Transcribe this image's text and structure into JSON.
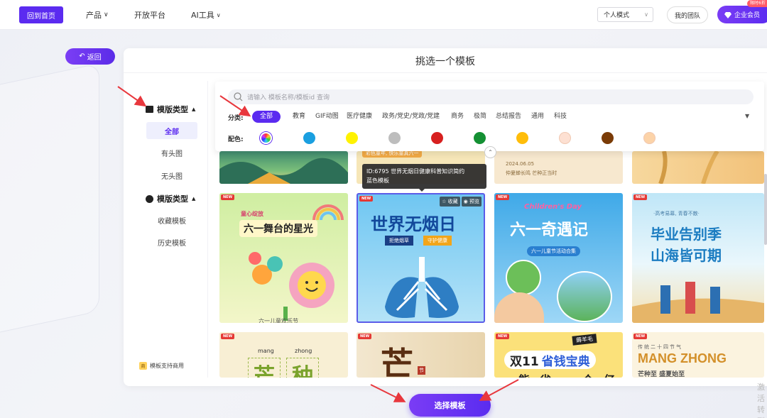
{
  "topbar": {
    "home_label": "回到首页",
    "nav": [
      {
        "label": "产品",
        "caret": true
      },
      {
        "label": "开放平台",
        "caret": false
      },
      {
        "label": "AI工具",
        "caret": true
      }
    ],
    "mode_select_value": "个人模式",
    "team_label": "我的团队",
    "vip_label": "企业会员",
    "vip_badge": "限时6折"
  },
  "back_label": "返回",
  "panel_title": "挑选一个模板",
  "sidebar": {
    "group1_title": "模版类型",
    "items1": [
      "全部",
      "有头图",
      "无头图"
    ],
    "group2_title": "模版类型",
    "items2": [
      "收藏模板",
      "历史模板"
    ],
    "note": "模板支持商用",
    "note_icon_text": "商"
  },
  "filter": {
    "search_placeholder": "请输入 模板名称/模板id 查询",
    "category_label": "分类:",
    "categories": [
      "全部",
      "教育",
      "GIF动图",
      "医疗健康",
      "政务/党史/党政/党建",
      "商务",
      "极简",
      "总结报告",
      "通用",
      "科技"
    ],
    "color_label": "配色:",
    "colors": [
      "rainbow",
      "#1a9fe0",
      "#fff200",
      "#bdbdbd",
      "#d7201f",
      "#149033",
      "#ffbd0a",
      "#fde0d2",
      "#7a3b06",
      "#fcd3a8"
    ]
  },
  "tooltip": {
    "line1": "ID:6795 世界无烟日健康科普知识简约",
    "line2": "蓝色模板"
  },
  "card_actions": {
    "collect": "收藏",
    "preview": "预览"
  },
  "new_badge": "NEW",
  "cards": {
    "top_row": {
      "card2_text": "彩色童年, 快乐童真六一",
      "card3_date": "2024.06.05",
      "card3_text": "仲夏蝉长鸣 芒种正当时"
    },
    "card_stage": {
      "banner": "童心绽放",
      "title": "六一舞台的星光",
      "bottom": "六一儿童欢乐节"
    },
    "card_smoke": {
      "title": "世界无烟日",
      "tag1": "拒绝烟草",
      "tag2": "守护健康"
    },
    "card_children": {
      "en": "Children's Day",
      "title": "六一奇遇记",
      "sub": "六一儿童节活动合集"
    },
    "card_grad": {
      "sub": "·高考易幕, 青春不散·",
      "line1": "毕业告别季",
      "line2": "山海皆可期"
    },
    "card_mangzhong": {
      "pinyin1": "mang",
      "pinyin2": "zhong",
      "char1": "芒",
      "char2": "种"
    },
    "card_wheat": {
      "char": "芒",
      "tag": "节"
    },
    "card_double11": {
      "badge": "薅羊毛",
      "prefix": "双11",
      "title": "省钱宝典",
      "bottom": "能省一个亿"
    },
    "card_mz_en": {
      "sub": "传统二十四节气",
      "title": "MANG ZHONG",
      "bottom": "芒种至 盛夏始至"
    }
  },
  "select_label": "选择模板",
  "watermark": "激活 转到"
}
